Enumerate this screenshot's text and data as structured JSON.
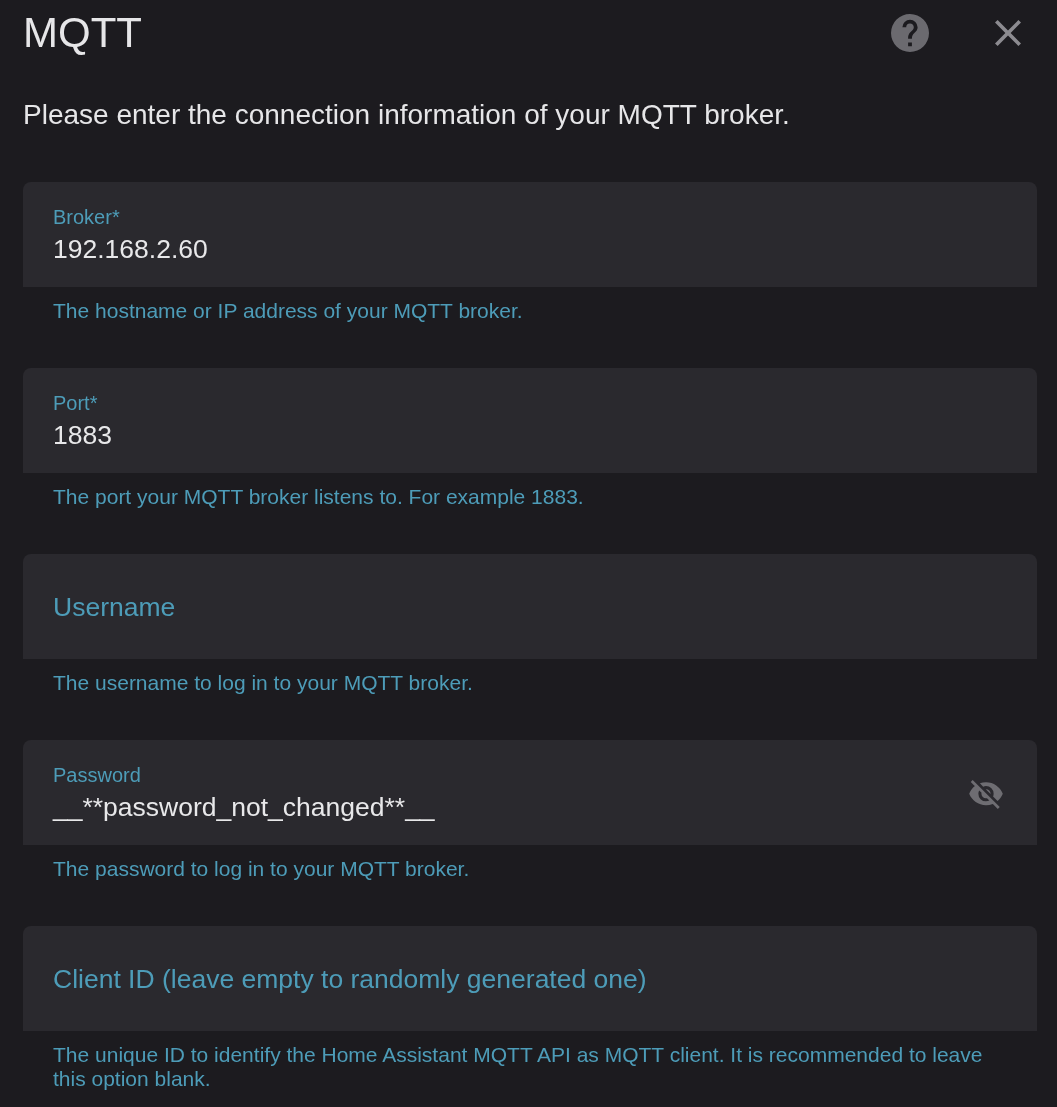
{
  "dialog": {
    "title": "MQTT",
    "description": "Please enter the connection information of your MQTT broker."
  },
  "fields": [
    {
      "kind": "text",
      "label": "Broker*",
      "value": "192.168.2.60",
      "helper": "The hostname or IP address of your MQTT broker."
    },
    {
      "kind": "text",
      "label": "Port*",
      "value": "1883",
      "helper": "The port your MQTT broker listens to. For example 1883."
    },
    {
      "kind": "text",
      "label": "Username",
      "helper": "The username to log in to your MQTT broker."
    },
    {
      "kind": "password",
      "label": "Password",
      "value": "__**password_not_changed**__",
      "revealed": true,
      "helper": "The password to log in to your MQTT broker."
    },
    {
      "kind": "text",
      "label": "Client ID (leave empty to randomly generated one)",
      "helper": "The unique ID to identify the Home Assistant MQTT API as MQTT client. It is recommended to leave this option blank."
    }
  ]
}
